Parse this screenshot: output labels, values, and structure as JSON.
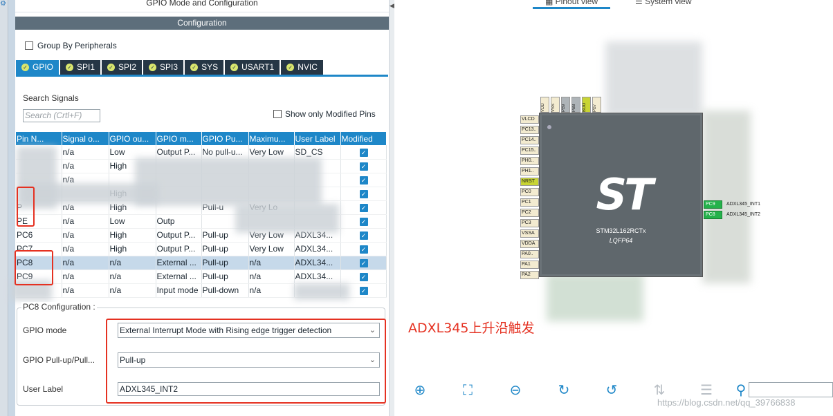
{
  "header": {
    "left_title": "GPIO Mode and Configuration",
    "config_title": "Configuration"
  },
  "group_by": {
    "label": "Group By Peripherals",
    "checked": false
  },
  "tabs": [
    {
      "label": "GPIO",
      "active": true
    },
    {
      "label": "SPI1"
    },
    {
      "label": "SPI2"
    },
    {
      "label": "SPI3"
    },
    {
      "label": "SYS"
    },
    {
      "label": "USART1"
    },
    {
      "label": "NVIC"
    }
  ],
  "search": {
    "label": "Search Signals",
    "placeholder": "Search (Crtl+F)"
  },
  "show_modified": {
    "label": "Show only Modified Pins",
    "checked": false
  },
  "table": {
    "columns": [
      "Pin N...",
      "Signal o...",
      "GPIO ou...",
      "GPIO m...",
      "GPIO Pu...",
      "Maximu...",
      "User Label",
      "Modified"
    ],
    "rows": [
      {
        "pin": "",
        "signal": "n/a",
        "output": "Low",
        "mode": "Output P...",
        "pull": "No pull-u...",
        "speed": "Very Low",
        "label": "SD_CS",
        "modified": true
      },
      {
        "pin": "",
        "signal": "n/a",
        "output": "High",
        "mode": "",
        "pull": "",
        "speed": "",
        "label": "",
        "modified": true
      },
      {
        "pin": "",
        "signal": "n/a",
        "output": "",
        "mode": "",
        "pull": "",
        "speed": "",
        "label": "",
        "modified": true
      },
      {
        "pin": "",
        "signal": "",
        "output": "High",
        "mode": "",
        "pull": "",
        "speed": "",
        "label": "",
        "modified": true
      },
      {
        "pin": "P",
        "signal": "n/a",
        "output": "High",
        "mode": "",
        "pull": "Pull-u",
        "speed": "Very Lo",
        "label": "",
        "modified": true
      },
      {
        "pin": "PE",
        "signal": "n/a",
        "output": "Low",
        "mode": "Outp",
        "pull": "",
        "speed": "",
        "label": "",
        "modified": true
      },
      {
        "pin": "PC6",
        "signal": "n/a",
        "output": "High",
        "mode": "Output P...",
        "pull": "Pull-up",
        "speed": "Very Low",
        "label": "ADXL34...",
        "modified": true
      },
      {
        "pin": "PC7",
        "signal": "n/a",
        "output": "High",
        "mode": "Output P...",
        "pull": "Pull-up",
        "speed": "Very Low",
        "label": "ADXL34...",
        "modified": true
      },
      {
        "pin": "PC8",
        "signal": "n/a",
        "output": "n/a",
        "mode": "External ...",
        "pull": "Pull-up",
        "speed": "n/a",
        "label": "ADXL34...",
        "modified": true,
        "selected": true
      },
      {
        "pin": "PC9",
        "signal": "n/a",
        "output": "n/a",
        "mode": "External ...",
        "pull": "Pull-up",
        "speed": "n/a",
        "label": "ADXL34...",
        "modified": true
      },
      {
        "pin": "",
        "signal": "n/a",
        "output": "n/a",
        "mode": "Input mode",
        "pull": "Pull-down",
        "speed": "n/a",
        "label": "",
        "modified": true
      }
    ]
  },
  "pc8_config": {
    "legend": "PC8 Configuration :",
    "gpio_mode_label": "GPIO mode",
    "gpio_mode_value": "External Interrupt Mode with Rising edge trigger detection",
    "pull_label": "GPIO Pull-up/Pull...",
    "pull_value": "Pull-up",
    "user_label_label": "User Label",
    "user_label_value": "ADXL345_INT2"
  },
  "annotation": "ADXL345上升沿触发",
  "right_tabs": {
    "pinout": "Pinout view",
    "system": "System view"
  },
  "chip": {
    "logo": "ST",
    "part": "STM32L162RCTx",
    "package": "LQFP64",
    "left_pins": [
      "VLCD",
      "PC13..",
      "PC14..",
      "PC15..",
      "PH0..",
      "PH1..",
      "NRST",
      "PC0",
      "PC1",
      "PC2",
      "PC3",
      "VSSA",
      "VDDA",
      "PA0..",
      "PA1",
      "PA2"
    ],
    "top_pins": [
      "VDD",
      "VSS",
      "PB9",
      "PB8",
      "BOO",
      "PB7"
    ],
    "right_pins": [
      {
        "pin": "PC9",
        "label": "ADXL345_INT1"
      },
      {
        "pin": "PC8",
        "label": "ADXL345_INT2"
      }
    ]
  },
  "watermark": "https://blog.csdn.net/qq_39766838",
  "colors": {
    "accent": "#1e87c8",
    "header_dark": "#263645",
    "red_mark": "#e53121",
    "pin_green": "#24b24b"
  }
}
